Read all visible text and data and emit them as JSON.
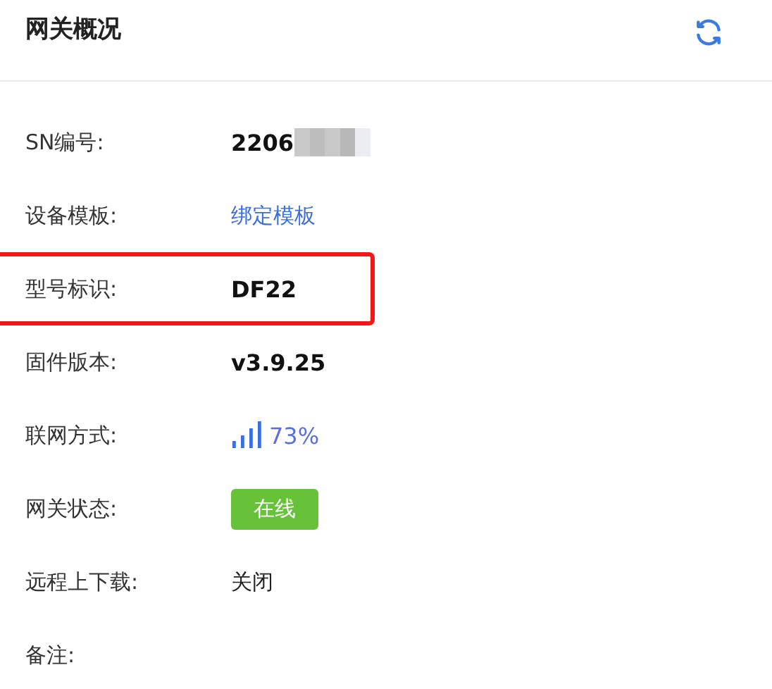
{
  "header": {
    "title": "网关概况"
  },
  "rows": [
    {
      "label": "SN编号:",
      "kind": "redacted",
      "value": "2206",
      "highlighted": false
    },
    {
      "label": "设备模板:",
      "kind": "link",
      "value": "绑定模板",
      "highlighted": false
    },
    {
      "label": "型号标识:",
      "kind": "bold",
      "value": "DF22",
      "highlighted": true
    },
    {
      "label": "固件版本:",
      "kind": "bold",
      "value": "v3.9.25",
      "highlighted": false
    },
    {
      "label": "联网方式:",
      "kind": "signal",
      "value": "73%",
      "highlighted": false
    },
    {
      "label": "网关状态:",
      "kind": "tag",
      "value": "在线",
      "highlighted": false
    },
    {
      "label": "远程上下载:",
      "kind": "plain",
      "value": "关闭",
      "highlighted": false
    },
    {
      "label": "备注:",
      "kind": "empty",
      "highlighted": false
    }
  ]
}
